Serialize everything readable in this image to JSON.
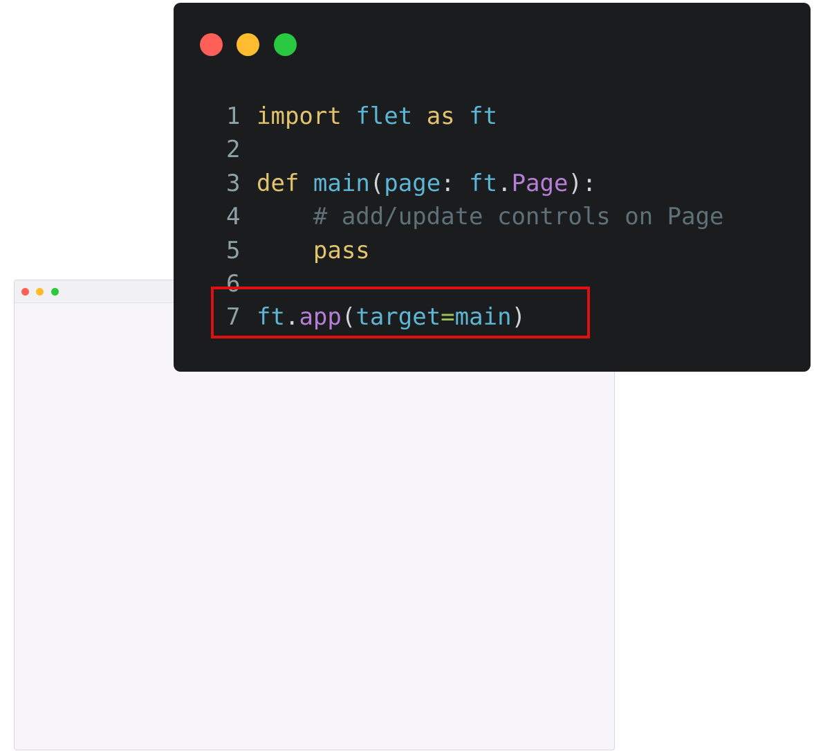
{
  "colors": {
    "dot_close": "#fe5f57",
    "dot_minimize": "#febc2e",
    "dot_zoom": "#28c840",
    "editor_bg": "#1b1c1e",
    "app_bg": "#f7f5f9",
    "highlight": "#e01010"
  },
  "code": {
    "lines": [
      {
        "number": "1",
        "tokens": [
          {
            "text": "import",
            "kind": "kw"
          },
          {
            "text": " ",
            "kind": "punc"
          },
          {
            "text": "flet",
            "kind": "mod"
          },
          {
            "text": " ",
            "kind": "punc"
          },
          {
            "text": "as",
            "kind": "kw"
          },
          {
            "text": " ",
            "kind": "punc"
          },
          {
            "text": "ft",
            "kind": "mod"
          }
        ]
      },
      {
        "number": "2",
        "tokens": []
      },
      {
        "number": "3",
        "tokens": [
          {
            "text": "def",
            "kind": "kw"
          },
          {
            "text": " ",
            "kind": "punc"
          },
          {
            "text": "main",
            "kind": "fn"
          },
          {
            "text": "(",
            "kind": "punc"
          },
          {
            "text": "page",
            "kind": "fn"
          },
          {
            "text": ": ",
            "kind": "punc"
          },
          {
            "text": "ft",
            "kind": "mod"
          },
          {
            "text": ".",
            "kind": "punc"
          },
          {
            "text": "Page",
            "kind": "cls"
          },
          {
            "text": "):",
            "kind": "punc"
          }
        ]
      },
      {
        "number": "4",
        "tokens": [
          {
            "text": "    ",
            "kind": "punc"
          },
          {
            "text": "# add/update controls on Page",
            "kind": "cmt"
          }
        ]
      },
      {
        "number": "5",
        "tokens": [
          {
            "text": "    ",
            "kind": "punc"
          },
          {
            "text": "pass",
            "kind": "kw"
          }
        ]
      },
      {
        "number": "6",
        "tokens": []
      },
      {
        "number": "7",
        "tokens": [
          {
            "text": "ft",
            "kind": "mod"
          },
          {
            "text": ".",
            "kind": "punc"
          },
          {
            "text": "app",
            "kind": "cls"
          },
          {
            "text": "(",
            "kind": "punc"
          },
          {
            "text": "target",
            "kind": "fn"
          },
          {
            "text": "=",
            "kind": "op"
          },
          {
            "text": "main",
            "kind": "fn"
          },
          {
            "text": ")",
            "kind": "punc"
          }
        ]
      }
    ]
  }
}
